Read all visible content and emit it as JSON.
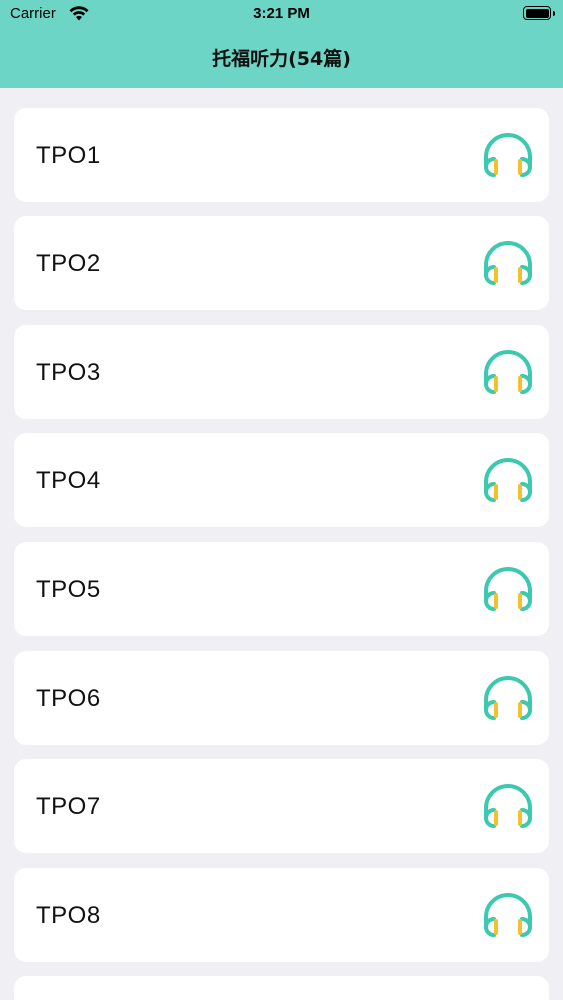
{
  "status_bar": {
    "carrier": "Carrier",
    "time": "3:21 PM"
  },
  "nav": {
    "title": "托福听力(54篇)"
  },
  "colors": {
    "header_bg": "#6dd5c6",
    "page_bg": "#efeff4",
    "headphone_teal": "#3cc9b0",
    "headphone_yellow": "#f2c12e"
  },
  "list": {
    "items": [
      {
        "label": "TPO1",
        "icon": "headphones-icon"
      },
      {
        "label": "TPO2",
        "icon": "headphones-icon"
      },
      {
        "label": "TPO3",
        "icon": "headphones-icon"
      },
      {
        "label": "TPO4",
        "icon": "headphones-icon"
      },
      {
        "label": "TPO5",
        "icon": "headphones-icon"
      },
      {
        "label": "TPO6",
        "icon": "headphones-icon"
      },
      {
        "label": "TPO7",
        "icon": "headphones-icon"
      },
      {
        "label": "TPO8",
        "icon": "headphones-icon"
      }
    ]
  }
}
